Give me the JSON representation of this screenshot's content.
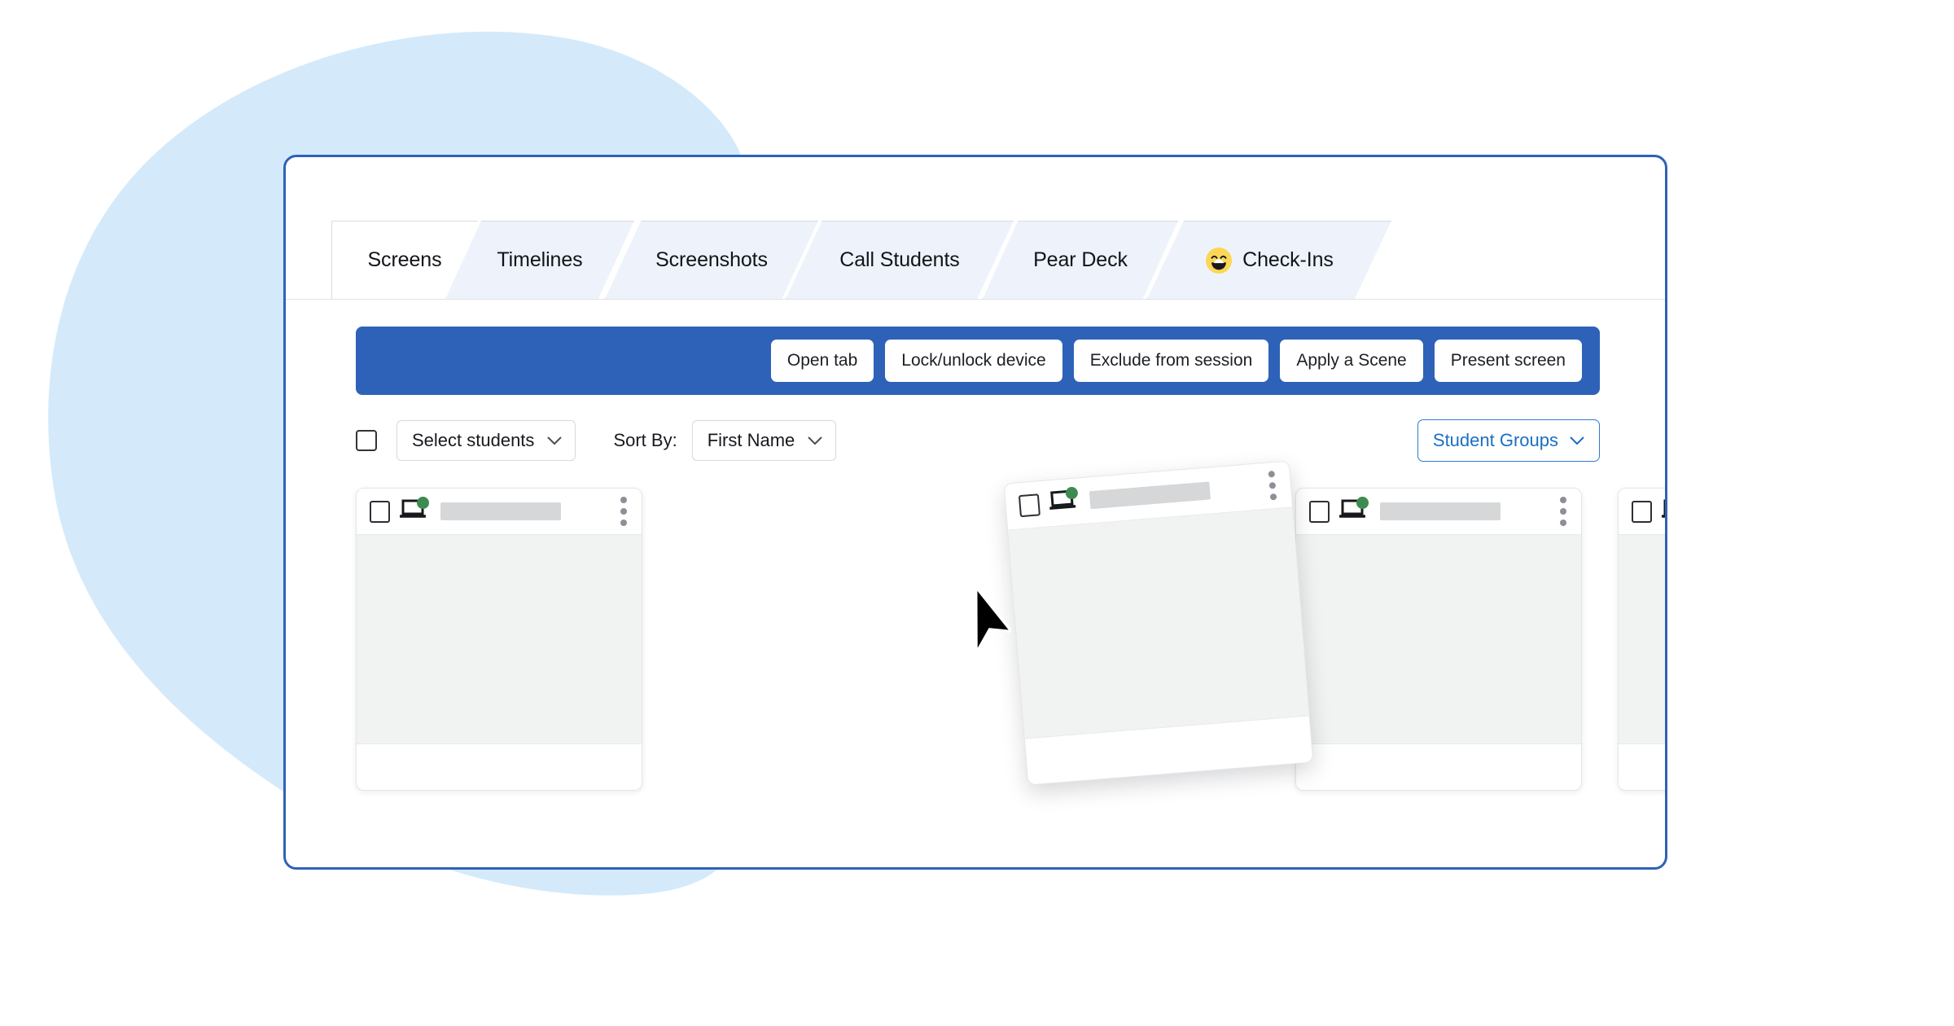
{
  "colors": {
    "blob": "#d4eafb",
    "frame_border": "#2e62b8",
    "toolbar_blue": "#2e62b8",
    "tab_active_bg": "#ffffff",
    "tab_inactive_bg": "#eef3fb",
    "link_blue": "#1a6fc4",
    "status_online_green": "#3d8b50",
    "card_screen_gray": "#f1f3f2",
    "placeholder_gray": "#d6d7d9"
  },
  "tabs": [
    {
      "label": "Screens",
      "active": true,
      "icon": null
    },
    {
      "label": "Timelines",
      "active": false,
      "icon": null
    },
    {
      "label": "Screenshots",
      "active": false,
      "icon": null
    },
    {
      "label": "Call Students",
      "active": false,
      "icon": null
    },
    {
      "label": "Pear Deck",
      "active": false,
      "icon": null
    },
    {
      "label": "Check-Ins",
      "active": false,
      "icon": "grinning-face-emoji"
    }
  ],
  "toolbar": {
    "buttons": [
      {
        "label": "Open tab"
      },
      {
        "label": "Lock/unlock device"
      },
      {
        "label": "Exclude from session"
      },
      {
        "label": "Apply a Scene"
      },
      {
        "label": "Present screen"
      }
    ]
  },
  "filter_row": {
    "master_checkbox_checked": false,
    "select_students": {
      "label": "Select students",
      "icon": "chevron-down-icon"
    },
    "sort_by_label": "Sort By:",
    "sort_value": {
      "label": "First Name",
      "icon": "chevron-down-icon"
    },
    "student_groups": {
      "label": "Student Groups",
      "icon": "chevron-down-icon"
    }
  },
  "cards": [
    {
      "checkbox_checked": false,
      "device": "laptop-icon",
      "status": "online",
      "name": "",
      "menu": "kebab-menu-icon",
      "dragging": false
    },
    {
      "checkbox_checked": false,
      "device": "laptop-icon",
      "status": "online",
      "name": "",
      "menu": "kebab-menu-icon",
      "dragging": true
    },
    {
      "checkbox_checked": false,
      "device": "laptop-icon",
      "status": "online",
      "name": "",
      "menu": "kebab-menu-icon",
      "dragging": false
    },
    {
      "checkbox_checked": false,
      "device": "laptop-icon",
      "status": "online",
      "name": "",
      "menu": "kebab-menu-icon",
      "dragging": false
    }
  ],
  "cursor": {
    "icon": "mouse-pointer-arrow",
    "state": "dragging"
  }
}
